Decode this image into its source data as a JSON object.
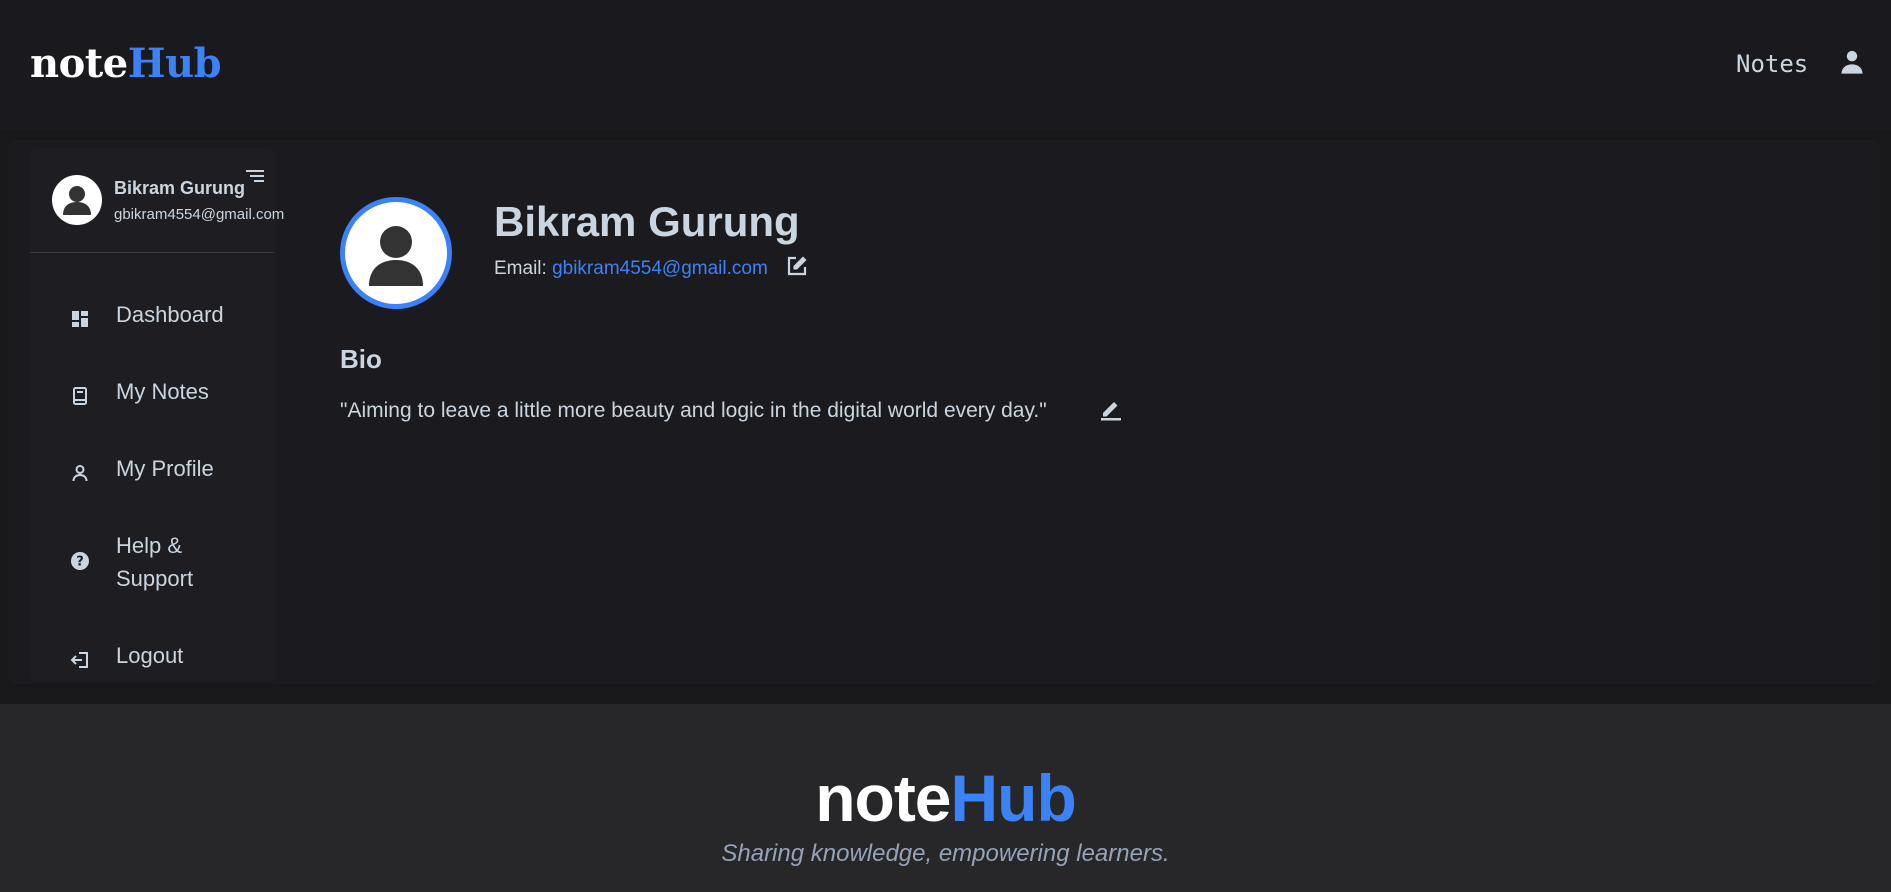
{
  "brand": {
    "part1": "note",
    "part2": "Hub",
    "accent_color": "#3b82f6"
  },
  "header": {
    "nav_notes": "Notes",
    "user_icon": "user-icon"
  },
  "sidebar": {
    "user_name": "Bikram Gurung",
    "user_email": "gbikram4554@gmail.com",
    "toggle_icon": "menu-toggle-icon",
    "items": [
      {
        "label": "Dashboard",
        "icon": "dashboard-icon"
      },
      {
        "label": "My Notes",
        "icon": "notebook-icon"
      },
      {
        "label": "My Profile",
        "icon": "user-icon"
      },
      {
        "label": "Help & Support",
        "icon": "help-icon"
      },
      {
        "label": "Logout",
        "icon": "logout-icon"
      }
    ]
  },
  "profile": {
    "name": "Bikram Gurung",
    "email_label": "Email:",
    "email": "gbikram4554@gmail.com",
    "edit_email_icon": "edit-icon",
    "bio_title": "Bio",
    "bio": "\"Aiming to leave a little more beauty and logic in the digital world every day.\"",
    "edit_bio_icon": "pencil-icon"
  },
  "footer": {
    "logo_part1": "note",
    "logo_part2": "Hub",
    "tagline": "Sharing knowledge, empowering learners."
  }
}
